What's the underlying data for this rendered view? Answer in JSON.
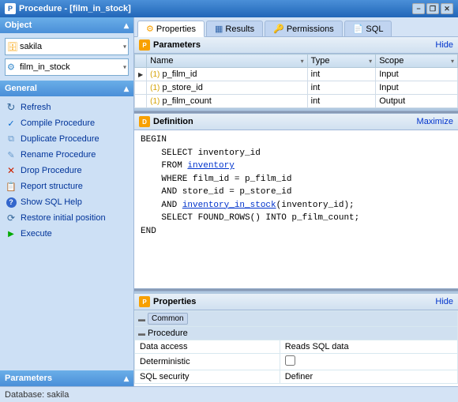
{
  "window": {
    "title": "Procedure - [film_in_stock]",
    "icon": "P"
  },
  "titlebar": {
    "buttons": {
      "minimize": "−",
      "restore": "❐",
      "close": "✕"
    }
  },
  "left": {
    "object_header": "Object",
    "database": {
      "value": "sakila",
      "options": [
        "sakila"
      ]
    },
    "procedure": {
      "value": "film_in_stock",
      "options": [
        "film_in_stock"
      ]
    },
    "general_header": "General",
    "actions": [
      {
        "id": "refresh",
        "label": "Refresh",
        "icon": "refresh"
      },
      {
        "id": "compile",
        "label": "Compile Procedure",
        "icon": "compile"
      },
      {
        "id": "duplicate",
        "label": "Duplicate Procedure",
        "icon": "duplicate"
      },
      {
        "id": "rename",
        "label": "Rename Procedure",
        "icon": "rename"
      },
      {
        "id": "drop",
        "label": "Drop Procedure",
        "icon": "drop"
      },
      {
        "id": "report",
        "label": "Report structure",
        "icon": "report"
      },
      {
        "id": "sqlhelp",
        "label": "Show SQL Help",
        "icon": "sqlhelp"
      },
      {
        "id": "restore",
        "label": "Restore initial position",
        "icon": "restore"
      },
      {
        "id": "execute",
        "label": "Execute",
        "icon": "execute"
      }
    ],
    "params_header": "Parameters"
  },
  "tabs": [
    {
      "id": "properties",
      "label": "Properties",
      "icon": "⚙",
      "active": true
    },
    {
      "id": "results",
      "label": "Results",
      "icon": "📊",
      "active": false
    },
    {
      "id": "permissions",
      "label": "Permissions",
      "icon": "🔑",
      "active": false
    },
    {
      "id": "sql",
      "label": "SQL",
      "icon": "📄",
      "active": false
    }
  ],
  "parameters_panel": {
    "title": "Parameters",
    "hide_label": "Hide",
    "columns": [
      {
        "label": "Name",
        "width": "35%"
      },
      {
        "label": "Type",
        "width": "30%"
      },
      {
        "label": "Scope",
        "width": "35%"
      }
    ],
    "rows": [
      {
        "icon": "key",
        "name": "p_film_id",
        "type": "int",
        "scope": "Input",
        "arrow": true
      },
      {
        "icon": "key",
        "name": "p_store_id",
        "type": "int",
        "scope": "Input",
        "arrow": false
      },
      {
        "icon": "key",
        "name": "p_film_count",
        "type": "int",
        "scope": "Output",
        "arrow": false
      }
    ]
  },
  "definition_panel": {
    "title": "Definition",
    "maximize_label": "Maximize",
    "code_lines": [
      {
        "text": "BEGIN",
        "indent": 0,
        "type": "plain"
      },
      {
        "text": "    SELECT inventory_id",
        "indent": 0,
        "type": "plain"
      },
      {
        "text": "    FROM ",
        "indent": 0,
        "type": "mixed",
        "link": "inventory",
        "link_pos": "after_from"
      },
      {
        "text": "    WHERE film_id = p_film_id",
        "indent": 0,
        "type": "plain"
      },
      {
        "text": "    AND store_id = p_store_id",
        "indent": 0,
        "type": "plain"
      },
      {
        "text": "    AND ",
        "indent": 0,
        "type": "mixed",
        "link": "inventory_in_stock",
        "link_text": "inventory_in_stock(inventory_id);",
        "link_after": ""
      },
      {
        "text": "    SELECT FOUND_ROWS() INTO p_film_count;",
        "indent": 0,
        "type": "plain"
      },
      {
        "text": "END",
        "indent": 0,
        "type": "plain"
      }
    ]
  },
  "properties_bottom": {
    "title": "Properties",
    "hide_label": "Hide",
    "sections": [
      {
        "type": "section",
        "label": "Common",
        "badge": true
      },
      {
        "type": "section",
        "label": "Procedure"
      },
      {
        "type": "row",
        "label": "Data access",
        "value": "Reads SQL data",
        "is_checkbox": false
      },
      {
        "type": "row",
        "label": "Deterministic",
        "value": "",
        "is_checkbox": true,
        "checked": false
      },
      {
        "type": "row",
        "label": "SQL security",
        "value": "Definer",
        "is_checkbox": false
      }
    ]
  },
  "status_bar": {
    "text": "Database: sakila"
  }
}
